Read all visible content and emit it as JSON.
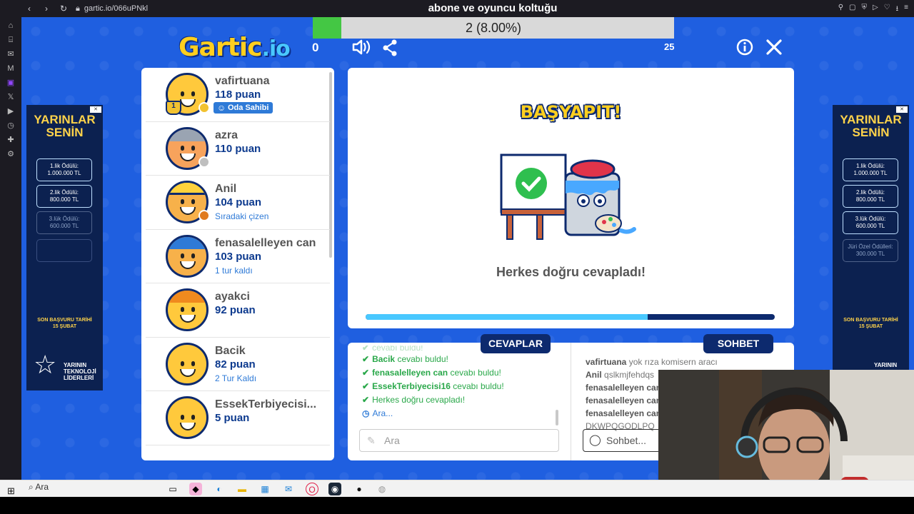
{
  "browser": {
    "url": "gartic.io/066uPNkl",
    "title": "abone ve oyuncu koltuğu"
  },
  "game": {
    "progress_text": "2 (8.00%)",
    "progress_fraction": 0.08,
    "logo": "Gartic",
    "logo_suffix": ".io",
    "score": "0",
    "round": "25"
  },
  "players": [
    {
      "name": "vafirtuana",
      "points": "118 puan",
      "badge": "Oda Sahibi",
      "rank": "1",
      "status_color": "#f2c230",
      "avatar_bg": "#ffc93c",
      "hair": "none"
    },
    {
      "name": "azra",
      "points": "110 puan",
      "extra": "",
      "status_color": "#bfbfbf",
      "avatar_bg": "#f7a35c",
      "hair": "grey"
    },
    {
      "name": "Anil",
      "points": "104 puan",
      "extra": "Sıradaki çizen",
      "status_color": "#e07b1f",
      "avatar_bg": "#f7b14a",
      "hair": "cap"
    },
    {
      "name": "fenasalelleyen can",
      "points": "103 puan",
      "extra": "1 tur kaldı",
      "status_color": "",
      "avatar_bg": "#f7b14a",
      "hair": "blue"
    },
    {
      "name": "ayakci",
      "points": "92 puan",
      "extra": "",
      "status_color": "",
      "avatar_bg": "#ffc93c",
      "hair": "orange"
    },
    {
      "name": "Bacik",
      "points": "82 puan",
      "extra": "2 Tur Kaldı",
      "status_color": "",
      "avatar_bg": "#ffc93c",
      "hair": "none"
    },
    {
      "name": "EssekTerbiyecisi...",
      "points": "5 puan",
      "extra": "",
      "status_color": "",
      "avatar_bg": "#ffc93c",
      "hair": "none"
    }
  ],
  "board": {
    "heading": "BAŞYAPIT!",
    "message": "Herkes doğru cevapladı!",
    "timer_fraction": 0.69
  },
  "tabs": {
    "answers": "CEVAPLAR",
    "chat": "SOHBET"
  },
  "answers": {
    "faded": "cevabı buldu!",
    "items": [
      {
        "name": "Bacik",
        "text": "cevabı buldu!"
      },
      {
        "name": "fenasalelleyen can",
        "text": "cevabı buldu!"
      },
      {
        "name": "EssekTerbiyecisi16",
        "text": "cevabı buldu!"
      },
      {
        "name": "",
        "text": "Herkes doğru cevapladı!"
      }
    ],
    "guess": "Ara...",
    "placeholder": "Ara"
  },
  "chat": {
    "lines": [
      {
        "name": "vafirtuana",
        "text": "yok rıza komisern aracı"
      },
      {
        "name": "Anil",
        "text": "qslkmjfehdqs"
      },
      {
        "name": "fenasalelleyen can",
        "text": ""
      },
      {
        "name": "fenasalelleyen can",
        "text": ""
      },
      {
        "name": "fenasalelleyen can",
        "text": ""
      },
      {
        "name": "",
        "text": "DKWPQGODLPQ"
      }
    ],
    "placeholder": "Sohbet..."
  },
  "ads": {
    "title_line1": "YARINLAR",
    "title_line2": "SENİN",
    "prize1": "1.lik Ödülü:",
    "prize1_val": "1.000.000 TL",
    "prize2": "2.lik Ödülü:",
    "prize2_val": "800.000 TL",
    "prize3": "3.lük Ödülü:",
    "prize3_val": "600.000 TL",
    "prize4": "Jüri Özel Ödülleri:",
    "prize4_val": "300.000 TL",
    "deadline1": "SON BAŞVURU TARİHİ",
    "deadline2": "15 ŞUBAT",
    "tag1": "YARININ",
    "tag2": "TEKNOLOJİ",
    "tag3": "LİDERLERİ"
  },
  "taskbar": {
    "search_label": "Ara"
  },
  "colors": {
    "game_bg": "#1f5fe0",
    "navy": "#0d2a6e",
    "accent_yellow": "#ffcf1f",
    "answer_green": "#2aa84a"
  }
}
